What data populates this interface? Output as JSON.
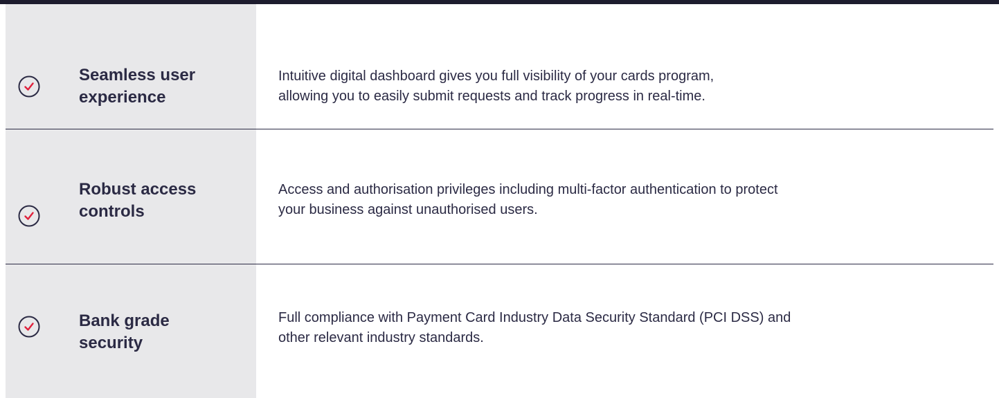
{
  "colors": {
    "top_bar": "#1d1c2e",
    "side_panel": "#e8e8ea",
    "title_text": "#2b2a44",
    "desc_text": "#2b2a44",
    "divider": "#2b2a44",
    "icon_circle": "#2b2a44",
    "icon_check": "#e0213c"
  },
  "features": [
    {
      "icon": "check-circle-icon",
      "title_line1": "Seamless user",
      "title_line2": "experience",
      "desc_line1": "Intuitive digital dashboard gives you full visibility of your cards program,",
      "desc_line2": "allowing you to easily submit requests and track progress in real-time."
    },
    {
      "icon": "check-circle-icon",
      "title_line1": "Robust access",
      "title_line2": "controls",
      "desc_line1": "Access and authorisation privileges including multi-factor authentication to protect",
      "desc_line2": "your business against unauthorised users."
    },
    {
      "icon": "check-circle-icon",
      "title_line1": "Bank grade",
      "title_line2": "security",
      "desc_line1": "Full compliance with Payment Card Industry Data Security Standard (PCI DSS) and",
      "desc_line2": "other relevant industry standards."
    }
  ]
}
